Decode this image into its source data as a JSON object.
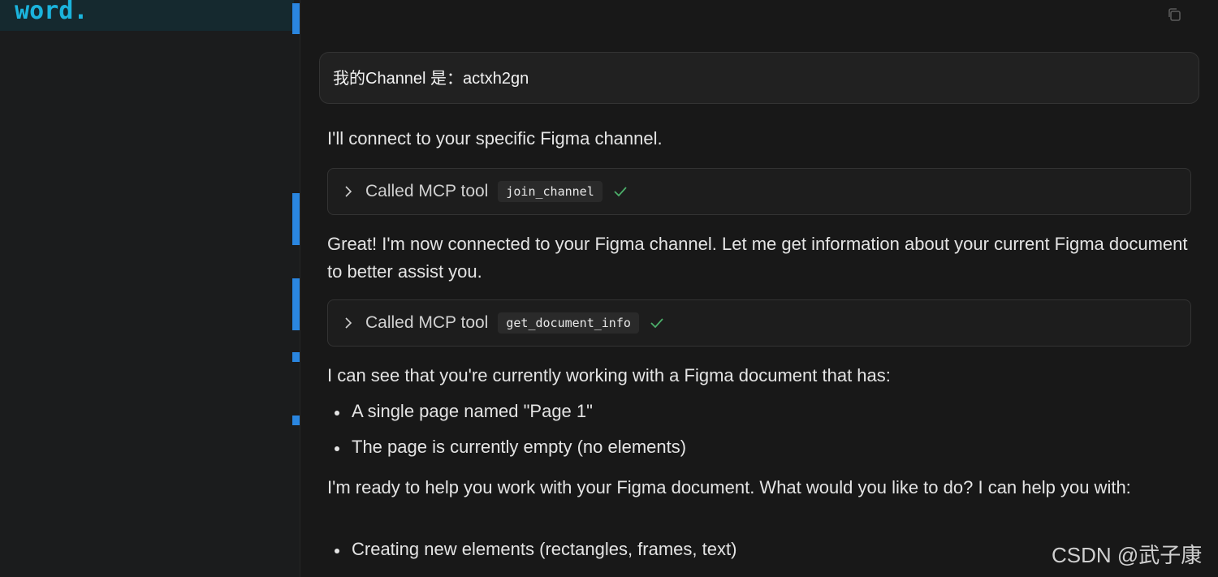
{
  "editor": {
    "visible_text": "n word."
  },
  "chat": {
    "user_message": "我的Channel 是：actxh2gn",
    "intro": "I'll connect to your specific Figma channel.",
    "tool_calls": [
      {
        "label": "Called MCP tool",
        "tool_name": "join_channel",
        "status": "success"
      },
      {
        "label": "Called MCP tool",
        "tool_name": "get_document_info",
        "status": "success"
      }
    ],
    "after_join": "Great! I'm now connected to your Figma channel. Let me get information about your current Figma document to better assist you.",
    "doc_summary": "I can see that you're currently working with a Figma document that has:",
    "doc_bullets": [
      "A single page named \"Page 1\"",
      "The page is currently empty (no elements)"
    ],
    "offer": "I'm ready to help you work with your Figma document. What would you like to do? I can help you with:",
    "offer_bullets": [
      "Creating new elements (rectangles, frames, text)"
    ]
  },
  "watermark": "CSDN @武子康",
  "icons": {
    "copy": "copy-icon",
    "chevron": "chevron-right-icon",
    "check": "checkmark-icon"
  },
  "colors": {
    "background": "#181818",
    "editor_text": "#1bb4dd",
    "gutter_accent": "#2a86e0",
    "check_green": "#4caf6a"
  }
}
